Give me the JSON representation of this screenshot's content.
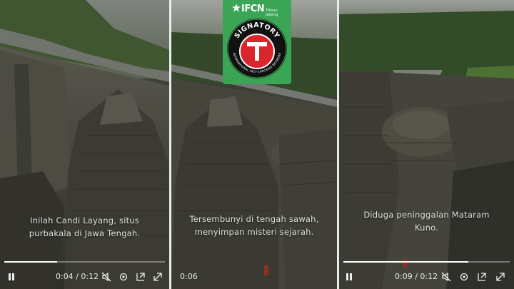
{
  "badge": {
    "brand_name": "IFCN",
    "brand_sub": "Tribun Jateng",
    "signatory_label": "SIGNATORY",
    "ring_text": "INTERNATIONAL FACT-CHECKING NETWORK",
    "letter": "T"
  },
  "panels": [
    {
      "caption_line1": "Inilah Candi Layang, situs",
      "caption_line2": "purbakala di Jawa Tengah.",
      "time": "0:04 / 0:12",
      "progress": 0.33,
      "show_full_controls": true
    },
    {
      "caption_line1": "Tersembunyi di tengah sawah,",
      "caption_line2": "menyimpan misteri sejarah.",
      "time": "0:06",
      "progress": 0.5,
      "show_full_controls": false
    },
    {
      "caption_line1": "Diduga peninggalan Mataram",
      "caption_line2": "Kuno.",
      "time": "0:09 / 0:12",
      "progress": 0.75,
      "show_full_controls": true
    }
  ],
  "icons": {
    "pause": "pause-icon",
    "mute": "mute-icon",
    "settings": "gear-icon",
    "pip": "picture-in-picture-icon",
    "fullscreen": "fullscreen-icon"
  },
  "colors": {
    "badge_green": "#3aa655",
    "badge_red": "#d8262c",
    "sky": "#b7bcb6",
    "rock": "#5b5a50"
  }
}
